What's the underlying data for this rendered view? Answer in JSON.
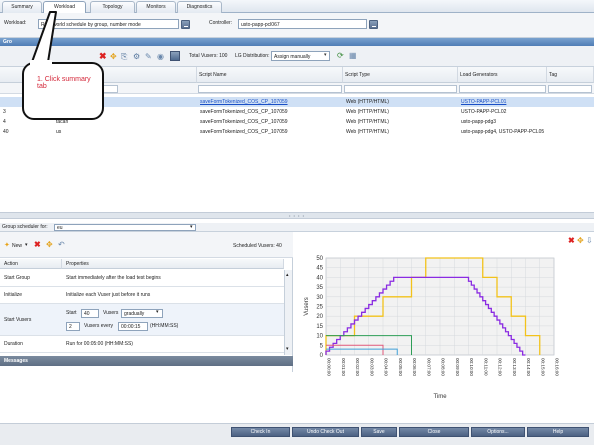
{
  "tabs": [
    {
      "label": "Summary"
    },
    {
      "label": "Workload"
    },
    {
      "label": "Topology"
    },
    {
      "label": "Monitors"
    },
    {
      "label": "Diagnostics"
    }
  ],
  "controls": {
    "workload_label": "Workload:",
    "workload_value": "Real-world schedule by group, number mode",
    "controller_label": "Controller:",
    "controller_value": "usto-papp-pcl067"
  },
  "groups_title": "Gro",
  "groups_toolbar": {
    "total_vusers": "Total Vusers: 100",
    "lg_distribution_label": "LG Distribution:",
    "lg_distribution_value": "Assign manually"
  },
  "grid": {
    "columns": [
      "Script Name",
      "Script Type",
      "Load Generators",
      "Tag"
    ],
    "rows": [
      {
        "id": "",
        "name": "",
        "script": "saveFormTokenized_COS_CP_107059",
        "type": "Web (HTTP/HTML)",
        "lg": "USTO-PAPP-PCL01",
        "link": true
      },
      {
        "id": "3",
        "name": "",
        "script": "saveFormTokenized_COS_CP_107059",
        "type": "Web (HTTP/HTML)",
        "lg": "USTO-PAPP-PCL02",
        "link": false
      },
      {
        "id": "4",
        "name": "tacan",
        "script": "saveFormTokenized_COS_CP_107059",
        "type": "Web (HTTP/HTML)",
        "lg": "usto-papp-pdg3",
        "link": false
      },
      {
        "id": "40",
        "name": "us",
        "script": "saveFormTokenized_COS_CP_107059",
        "type": "Web (HTTP/HTML)",
        "lg": "usto-papp-pdg4, USTO-PAPP-PCL05",
        "link": false
      }
    ]
  },
  "scheduler": {
    "label": "Group scheduler for:",
    "value": "eu",
    "new_label": "New",
    "scheduled_vusers": "Scheduled Vusers: 40",
    "col_action": "Action",
    "col_properties": "Properties",
    "rows": [
      {
        "action": "Start Group",
        "properties": "Start immediately after the load test begins"
      },
      {
        "action": "Initialize",
        "properties": "Initialize each Vuser just before it runs"
      },
      {
        "action": "Start Vusers",
        "properties": ""
      },
      {
        "action": "Duration",
        "properties": "Run for 00:05:00 (HH:MM:SS)"
      }
    ],
    "start_label": "Start",
    "start_value": "40",
    "vusers_label": "Vusers",
    "mode_value": "gradually",
    "step_value": "2",
    "vusers_every_label": "Vusers every",
    "interval_value": "00:00:15",
    "interval_format": "(HH:MM:SS)",
    "messages_label": "Messages"
  },
  "chart_data": {
    "type": "line",
    "ylabel": "Vusers",
    "xlabel": "Time",
    "ylim": [
      0,
      50
    ],
    "yticks": [
      0,
      5,
      10,
      15,
      20,
      25,
      30,
      35,
      40,
      45,
      50
    ],
    "xlim": [
      0,
      16
    ],
    "xticks": [
      "00:00:00",
      "00:01:00",
      "00:02:00",
      "00:03:00",
      "00:04:00",
      "00:05:00",
      "00:06:00",
      "00:07:00",
      "00:08:00",
      "00:09:00",
      "00:10:00",
      "00:11:00",
      "00:12:00",
      "00:13:00",
      "00:14:00",
      "00:15:00",
      "00:16:00"
    ],
    "grid": true,
    "series": [
      {
        "color": "#f2c21b",
        "width": 1.3,
        "points": [
          [
            0,
            0
          ],
          [
            0,
            10
          ],
          [
            2,
            10
          ],
          [
            2,
            20
          ],
          [
            4,
            20
          ],
          [
            4,
            30
          ],
          [
            6,
            30
          ],
          [
            6,
            40
          ],
          [
            7,
            40
          ],
          [
            7,
            50
          ],
          [
            11,
            50
          ],
          [
            11,
            40
          ],
          [
            12,
            40
          ],
          [
            12,
            30
          ],
          [
            13,
            30
          ],
          [
            13,
            20
          ],
          [
            14,
            20
          ],
          [
            14,
            10
          ],
          [
            15,
            10
          ],
          [
            15,
            0
          ]
        ]
      },
      {
        "color": "#8a2be2",
        "width": 1.3,
        "points": [
          [
            0,
            0
          ],
          [
            5,
            40
          ],
          [
            10,
            40
          ],
          [
            14,
            0
          ]
        ],
        "stepped": true
      },
      {
        "color": "#e0587a",
        "width": 1.0,
        "points": [
          [
            0,
            5
          ],
          [
            4,
            5
          ],
          [
            4,
            0
          ]
        ]
      },
      {
        "color": "#2e9e57",
        "width": 1.0,
        "points": [
          [
            0,
            10
          ],
          [
            6,
            10
          ],
          [
            6,
            0
          ]
        ]
      },
      {
        "color": "#3fa0d8",
        "width": 1.0,
        "points": [
          [
            0,
            3
          ],
          [
            5,
            3
          ],
          [
            5,
            0
          ]
        ]
      }
    ]
  },
  "buttons": {
    "check_in": "Check In",
    "undo_checkout": "Undo Check Out",
    "save": "Save",
    "close": "Close",
    "options": "Options...",
    "help": "Help"
  },
  "callout_text": "1. Click summary tab"
}
